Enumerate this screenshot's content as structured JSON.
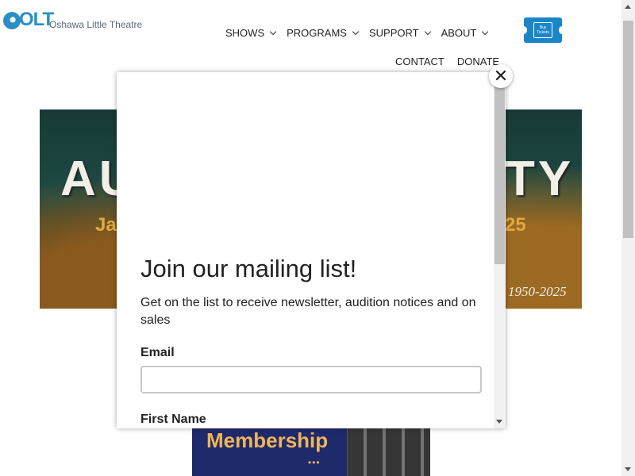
{
  "header": {
    "logo_mark": "OLT",
    "logo_text": "Oshawa Little Theatre",
    "nav": [
      {
        "label": "SHOWS"
      },
      {
        "label": "PROGRAMS"
      },
      {
        "label": "SUPPORT"
      },
      {
        "label": "ABOUT"
      }
    ],
    "nav_secondary": [
      {
        "label": "CONTACT"
      },
      {
        "label": "DONATE"
      }
    ],
    "buy_tickets": "Buy Tickets"
  },
  "hero": {
    "title_left": "AU",
    "title_right": "TY",
    "subtitle_left": "Ja",
    "subtitle_right": "25",
    "years": "1950-2025"
  },
  "banner": {
    "text": "Membership",
    "dots": "•••"
  },
  "modal": {
    "title": "Join our mailing list!",
    "description": "Get on the list to receive newsletter, audition notices and on sales",
    "email_label": "Email",
    "email_value": "",
    "first_name_label": "First Name",
    "close_symbol": "✕"
  },
  "colors": {
    "brand_blue": "#2a8fc6",
    "ticket_blue": "#1a86c8",
    "membership_navy": "#1f2a6b",
    "membership_gold": "#f0b55a"
  }
}
